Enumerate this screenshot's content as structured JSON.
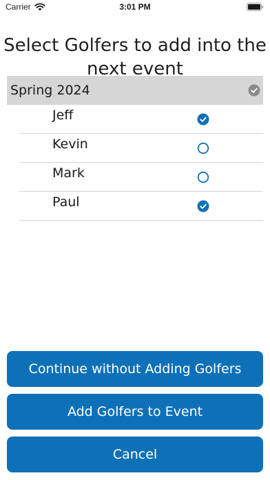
{
  "status_bar": {
    "carrier": "Carrier",
    "time": "3:01 PM"
  },
  "page": {
    "title": "Select Golfers to add into the next event"
  },
  "group": {
    "name": "Spring 2024",
    "all_selected": true
  },
  "golfers": [
    {
      "name": "Jeff",
      "selected": true
    },
    {
      "name": "Kevin",
      "selected": false
    },
    {
      "name": "Mark",
      "selected": false
    },
    {
      "name": "Paul",
      "selected": true
    }
  ],
  "buttons": {
    "continue_label": "Continue without Adding Golfers",
    "add_label": "Add Golfers to Event",
    "cancel_label": "Cancel"
  },
  "colors": {
    "accent": "#0e71b8",
    "group_header_bg": "#d6d6d6",
    "group_check": "#8a8a8a"
  },
  "icons": {
    "checked": "checkmark-circle-filled-icon",
    "unchecked": "circle-outline-icon"
  }
}
